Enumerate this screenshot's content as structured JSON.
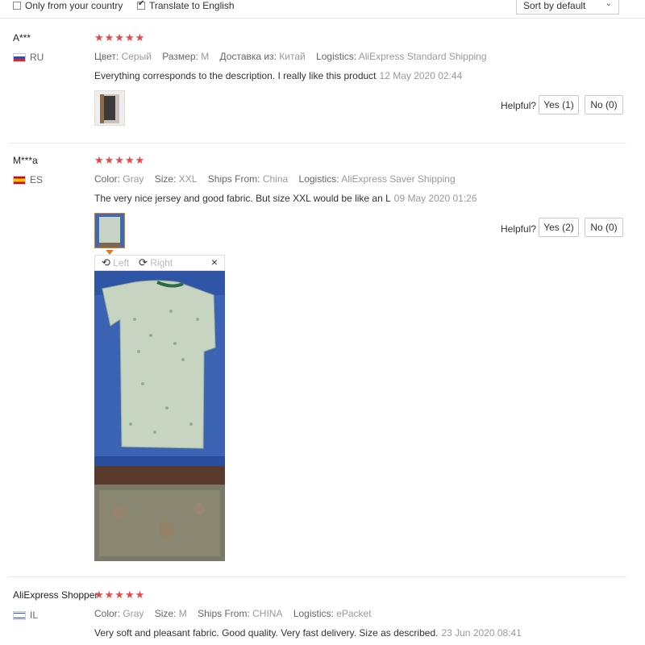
{
  "filters": {
    "only_country_label": "Only from your country",
    "translate_label": "Translate to English",
    "sort_value": "Sort by default"
  },
  "colors": {
    "star": "#e8464a",
    "accent": "#e07b2a"
  },
  "reviews": [
    {
      "user": "A***",
      "country": "RU",
      "stars": "★★★★★",
      "attrs": [
        {
          "k": "Цвет:",
          "v": "Серый"
        },
        {
          "k": "Размер:",
          "v": "M"
        },
        {
          "k": "Доставка из:",
          "v": "Китай"
        },
        {
          "k": "Logistics:",
          "v": "AliExpress Standard Shipping"
        }
      ],
      "text": "Everything corresponds to the description. I really like this product",
      "date": "12 May 2020 02:44",
      "helpful_label": "Helpful?",
      "yes": "Yes (1)",
      "no": "No (0)"
    },
    {
      "user": "M***a",
      "country": "ES",
      "stars": "★★★★★",
      "attrs": [
        {
          "k": "Color:",
          "v": "Gray"
        },
        {
          "k": "Size:",
          "v": "XXL"
        },
        {
          "k": "Ships From:",
          "v": "China"
        },
        {
          "k": "Logistics:",
          "v": "AliExpress Saver Shipping"
        }
      ],
      "text": "The very nice jersey and good fabric. But size XXL would be like an L",
      "date": "09 May 2020 01:26",
      "helpful_label": "Helpful?",
      "yes": "Yes (2)",
      "no": "No (0)",
      "viewer": {
        "left": "Left",
        "right": "Right",
        "close": "×"
      }
    },
    {
      "user": "AliExpress Shopper",
      "country": "IL",
      "stars": "★★★★★",
      "attrs": [
        {
          "k": "Color:",
          "v": "Gray"
        },
        {
          "k": "Size:",
          "v": "M"
        },
        {
          "k": "Ships From:",
          "v": "CHINA"
        },
        {
          "k": "Logistics:",
          "v": "ePacket"
        }
      ],
      "text": "Very soft and pleasant fabric. Good quality. Very fast delivery. Size as described.",
      "date": "23 Jun 2020 08:41"
    }
  ]
}
